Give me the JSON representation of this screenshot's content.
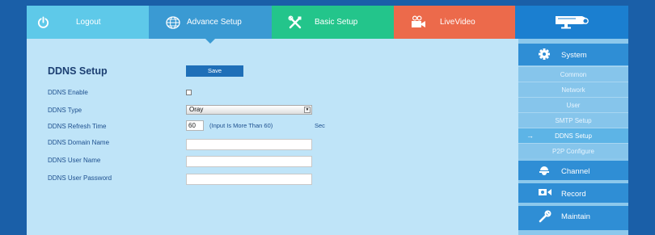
{
  "nav": {
    "logout": "Logout",
    "advance_setup": "Advance Setup",
    "basic_setup": "Basic Setup",
    "live_video": "LiveVideo"
  },
  "form": {
    "title": "DDNS Setup",
    "save": "Save",
    "enable_label": "DDNS Enable",
    "enable_checked": false,
    "type_label": "DDNS Type",
    "type_value": "Oray",
    "refresh_label": "DDNS Refresh Time",
    "refresh_value": "60",
    "refresh_hint": "(Input Is More Than 60)",
    "refresh_unit": "Sec",
    "domain_label": "DDNS Domain Name",
    "domain_value": "",
    "user_label": "DDNS User Name",
    "user_value": "",
    "password_label": "DDNS User Password",
    "password_value": ""
  },
  "sidebar": {
    "system": "System",
    "items": [
      "Common",
      "Network",
      "User",
      "SMTP Setup",
      "DDNS Setup",
      "P2P Configure"
    ],
    "active": "DDNS Setup",
    "channel": "Channel",
    "record": "Record",
    "maintain": "Maintain"
  }
}
